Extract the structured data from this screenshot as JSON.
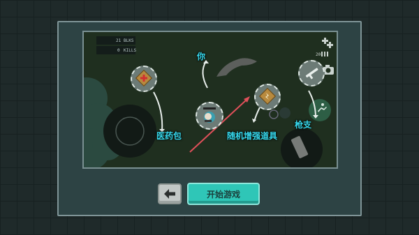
{
  "hud": {
    "kills_count": "21",
    "kills_label": "BLKS",
    "score_count": "0",
    "score_label": "KILLS",
    "ammo_count": "20"
  },
  "labels": {
    "you": "你",
    "medkit": "医药包",
    "random_powerup": "随机增强道具",
    "gun": "枪支"
  },
  "buttons": {
    "back_icon": "arrow-left-icon",
    "start": "开始游戏"
  },
  "colors": {
    "label": "#36d9ee",
    "start_button": "#2fc6b7",
    "arrow": "#e0505a"
  }
}
